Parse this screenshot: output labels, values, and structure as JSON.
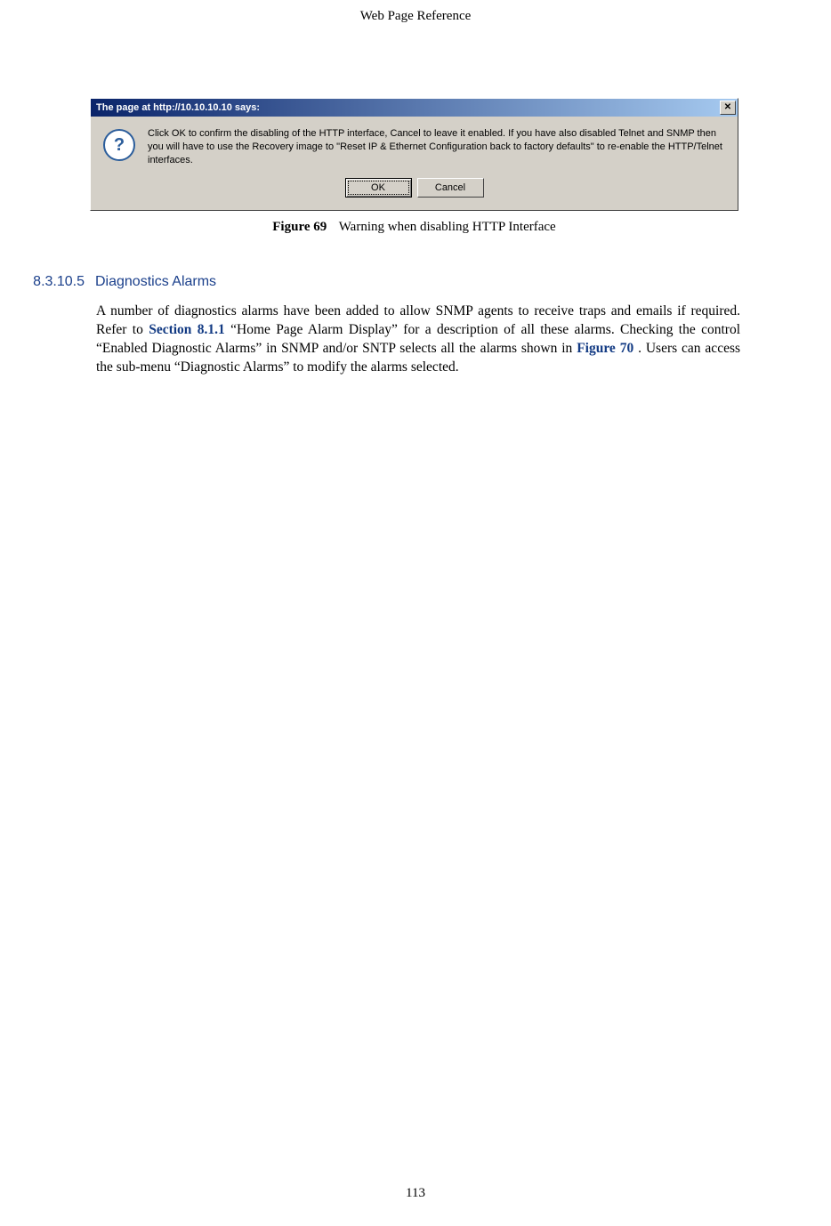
{
  "page_header": "Web Page Reference",
  "page_number": "113",
  "dialog": {
    "titlebar": "The page at http://10.10.10.10 says:",
    "message": "Click OK to confirm the disabling of the HTTP interface, Cancel to leave it enabled.  If you have also disabled Telnet and SNMP then you will have to use the Recovery image to \"Reset IP & Ethernet Configuration back to factory defaults\" to re-enable the HTTP/Telnet interfaces.",
    "ok_label": "OK",
    "cancel_label": "Cancel",
    "close_symbol": "✕"
  },
  "caption": {
    "label": "Figure 69",
    "text": "Warning when disabling HTTP Interface"
  },
  "section": {
    "number": "8.3.10.5",
    "title": "Diagnostics Alarms",
    "body_before_xref1": "A number of diagnostics alarms have been added to allow SNMP agents to receive traps and emails if required. Refer to ",
    "xref1": "Section 8.1.1",
    "body_mid": " “Home Page Alarm Display” for a description of all these alarms. Checking the control “Enabled Diagnostic Alarms” in SNMP and/or SNTP selects all the alarms shown in ",
    "xref2": "Figure 70",
    "body_after_xref2": ". Users can access the sub-menu “Diagnostic Alarms” to modify the alarms selected."
  }
}
